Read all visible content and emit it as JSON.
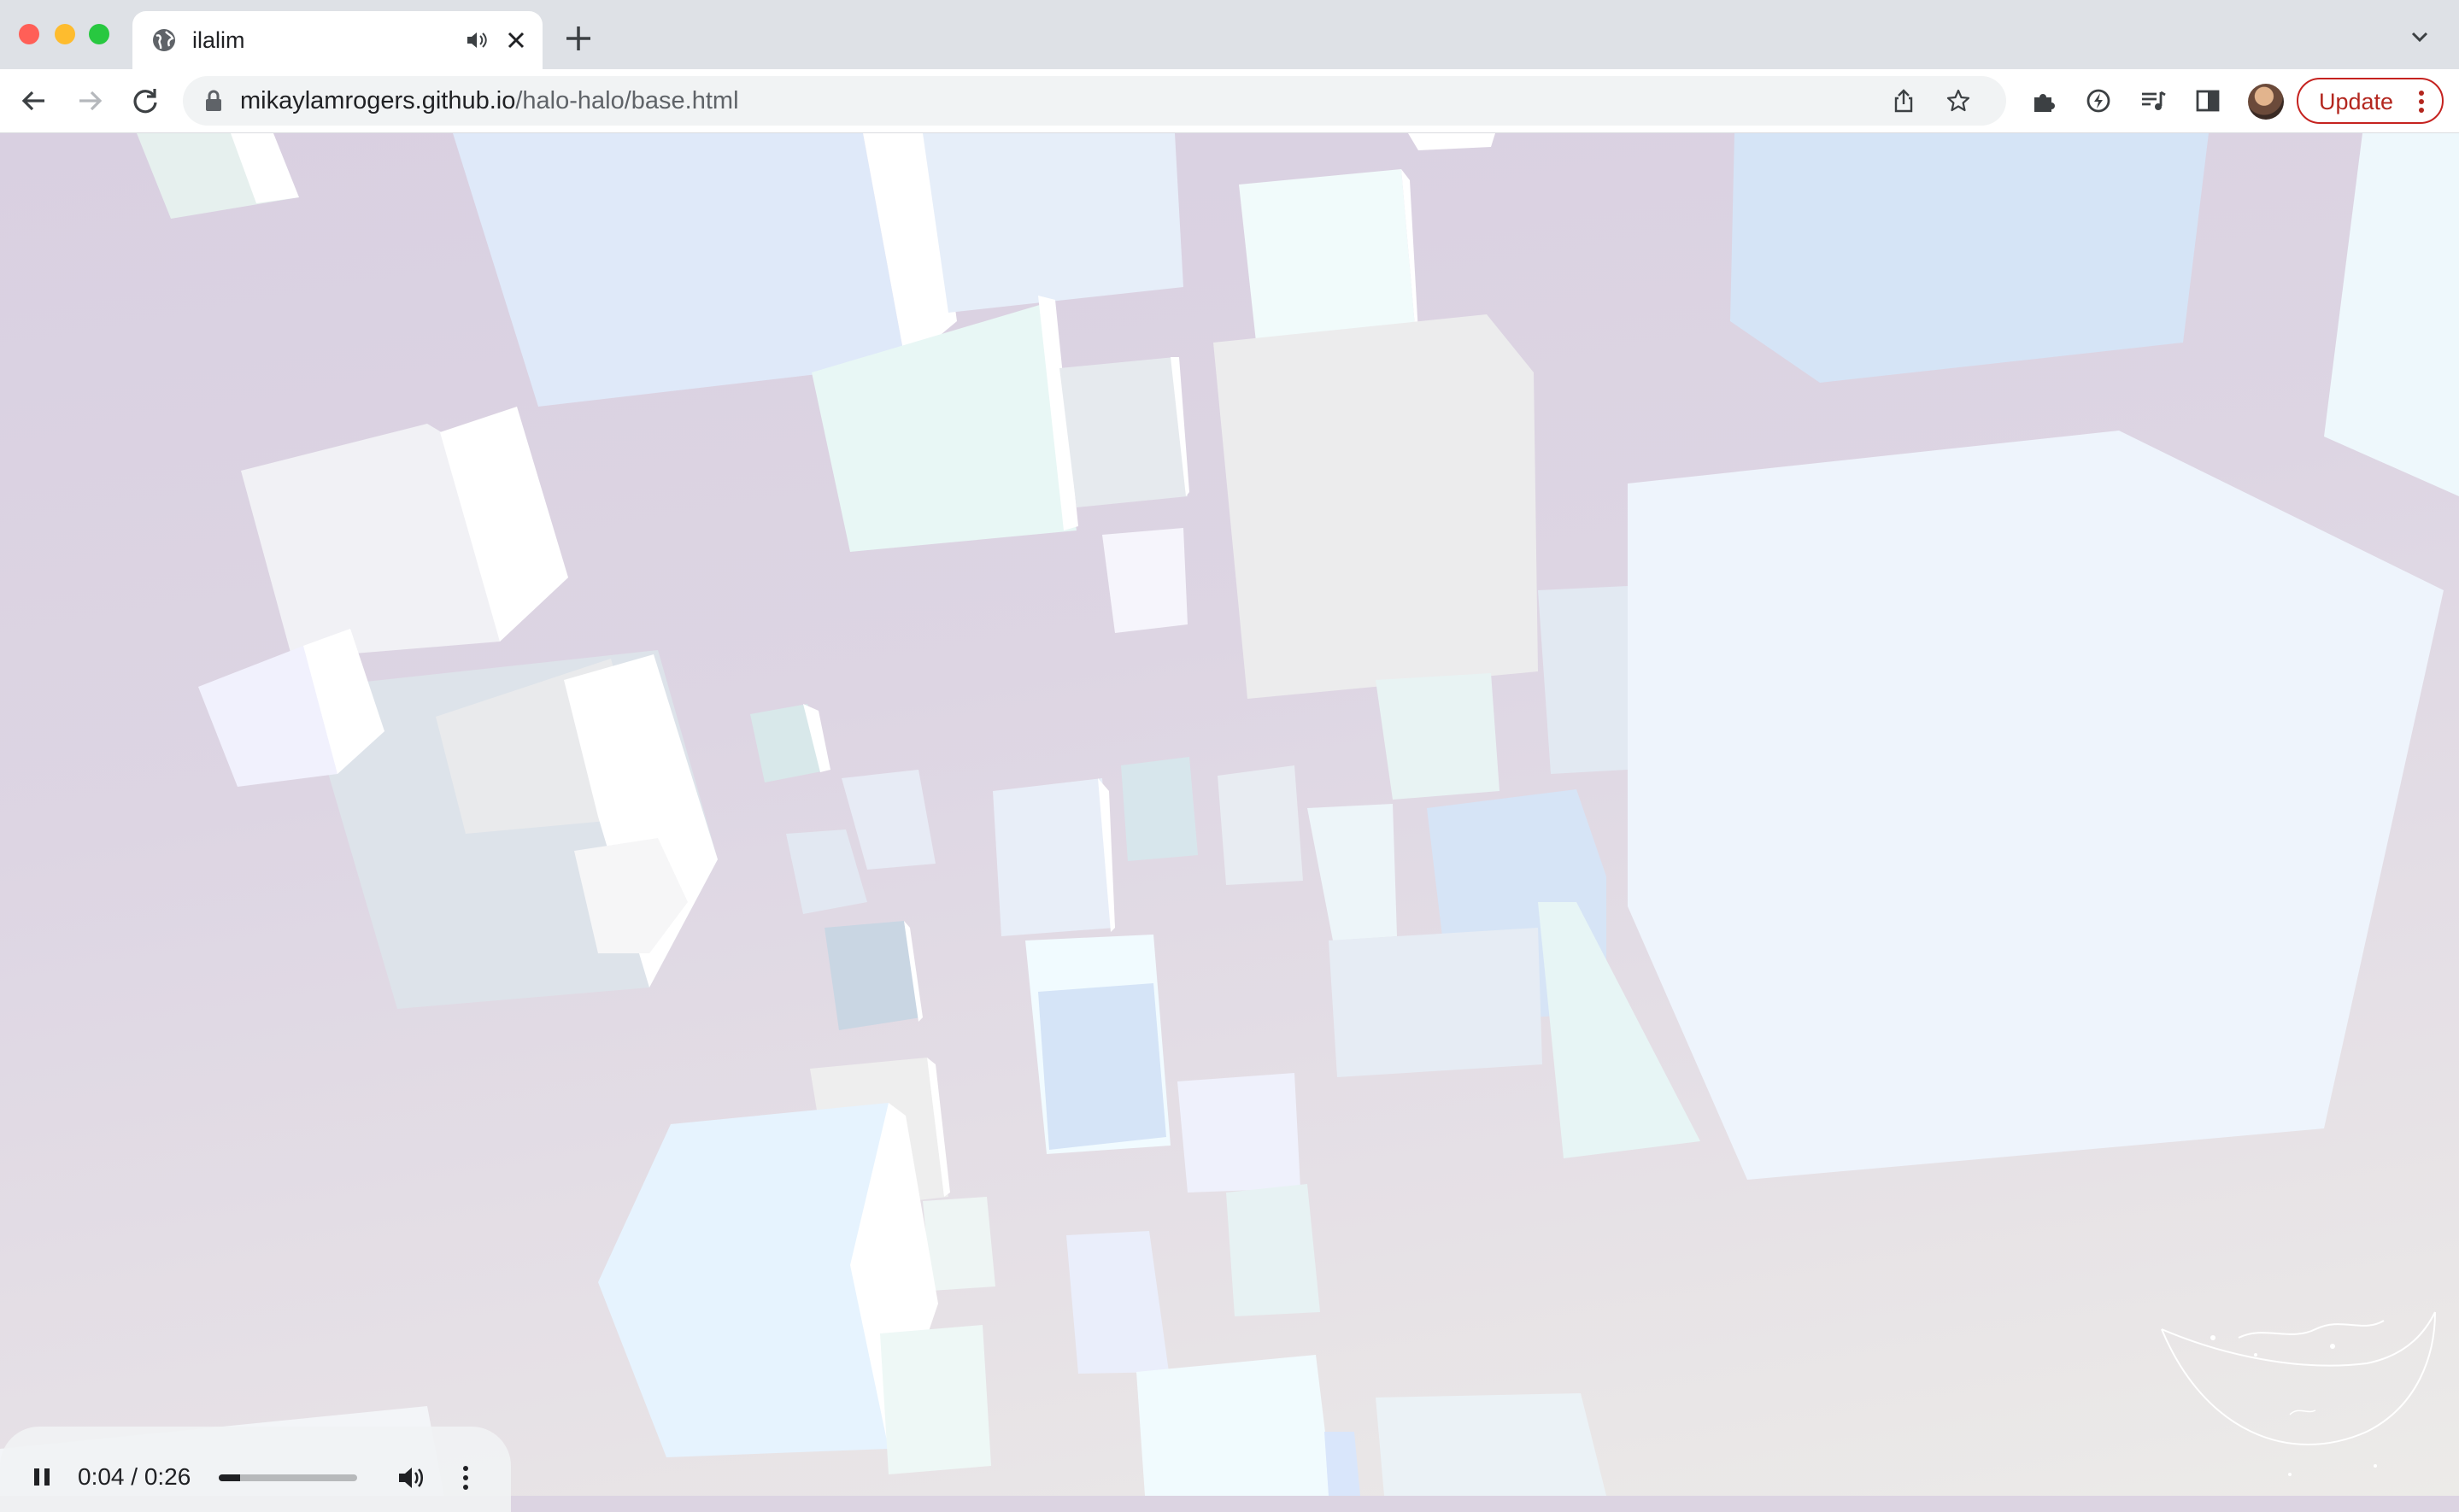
{
  "window": {
    "traffic_lights": [
      "close",
      "minimize",
      "zoom"
    ]
  },
  "tab": {
    "title": "ilalim",
    "favicon": "globe-icon",
    "audio_icon": "speaker-icon",
    "close_icon": "close-icon"
  },
  "new_tab": {
    "label": "+"
  },
  "toolbar": {
    "url_domain": "mikaylamrogers.github.io",
    "url_path": "/halo-halo/base.html",
    "update_label": "Update",
    "icons": [
      "back-arrow-icon",
      "forward-arrow-icon",
      "reload-icon",
      "lock-icon",
      "share-icon",
      "star-icon",
      "extensions-puzzle-icon",
      "extension-icon",
      "media-queue-icon",
      "side-panel-icon",
      "profile-avatar",
      "kebab-menu-icon"
    ]
  },
  "video": {
    "time_display": "0:04 / 0:26",
    "progress_fraction": 0.154,
    "state": "playing",
    "icons": [
      "pause-icon",
      "volume-icon",
      "more-options-icon"
    ]
  },
  "colors": {
    "background_lavender": "#dcd4e2",
    "update_red": "#c5221f",
    "cube_palette": [
      "#f3f4fa",
      "#e2ecfb",
      "#eaf8f8",
      "#dde6ee",
      "#d4e4f8",
      "#edf5fd"
    ]
  }
}
